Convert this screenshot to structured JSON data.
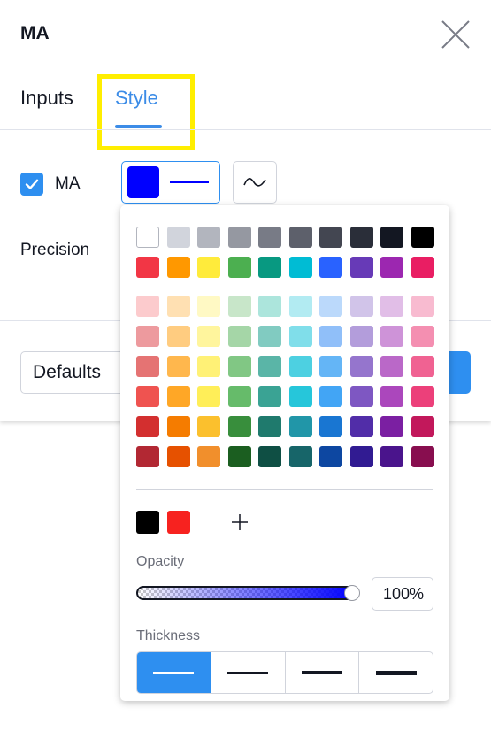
{
  "dialog": {
    "title": "MA",
    "tabs": [
      {
        "label": "Inputs",
        "active": false
      },
      {
        "label": "Style",
        "active": true
      }
    ],
    "highlight_color": "#ffee00"
  },
  "style": {
    "plot": {
      "checked": true,
      "label": "MA",
      "color": "#0000ff"
    },
    "precision_label": "Precision"
  },
  "footer": {
    "defaults_label": "Defaults"
  },
  "color_picker": {
    "top_rows": [
      [
        "#ffffff",
        "#d1d4dc",
        "#b2b5be",
        "#9598a1",
        "#787b86",
        "#5d606b",
        "#434651",
        "#2a2e39",
        "#131722",
        "#000000"
      ],
      [
        "#f23645",
        "#ff9800",
        "#ffeb3b",
        "#4caf50",
        "#089981",
        "#00bcd4",
        "#2962ff",
        "#673ab7",
        "#9c27b0",
        "#e91e63"
      ]
    ],
    "shade_rows": [
      [
        "#fccbcd",
        "#ffe0b2",
        "#fff9c4",
        "#c8e6c9",
        "#ace5dc",
        "#b2ebf2",
        "#bbd9fb",
        "#d1c4e9",
        "#e1bee7",
        "#f8bbd0"
      ],
      [
        "#ed9a9e",
        "#ffcc80",
        "#fff59d",
        "#a5d6a7",
        "#81cbc1",
        "#80deea",
        "#90bff9",
        "#b39ddb",
        "#ce93d8",
        "#f48fb1"
      ],
      [
        "#e57373",
        "#ffb74d",
        "#fff176",
        "#81c784",
        "#5ab5a7",
        "#4dd0e1",
        "#64b5f6",
        "#9575cd",
        "#ba68c8",
        "#f06292"
      ],
      [
        "#ef5350",
        "#ffa726",
        "#ffee58",
        "#66bb6a",
        "#3aa394",
        "#26c6da",
        "#42a5f5",
        "#7e57c2",
        "#ab47bc",
        "#ec407a"
      ],
      [
        "#d32f2f",
        "#f57c00",
        "#fbc02d",
        "#388e3c",
        "#1f7a6d",
        "#2196a8",
        "#1976d2",
        "#512da8",
        "#7b1fa2",
        "#c2185b"
      ],
      [
        "#b22833",
        "#e65100",
        "#f18f2c",
        "#1b5e20",
        "#0f4f44",
        "#176569",
        "#0d47a1",
        "#311b92",
        "#4a148c",
        "#880e4f"
      ]
    ],
    "recent_colors": [
      "#000000",
      "#f7221f"
    ],
    "add_icon": "plus-icon",
    "opacity_label": "Opacity",
    "opacity_value": "100%",
    "opacity_fraction": 1.0,
    "thickness_label": "Thickness",
    "thickness_options": [
      1,
      2,
      3,
      4
    ],
    "thickness_selected": 1
  }
}
